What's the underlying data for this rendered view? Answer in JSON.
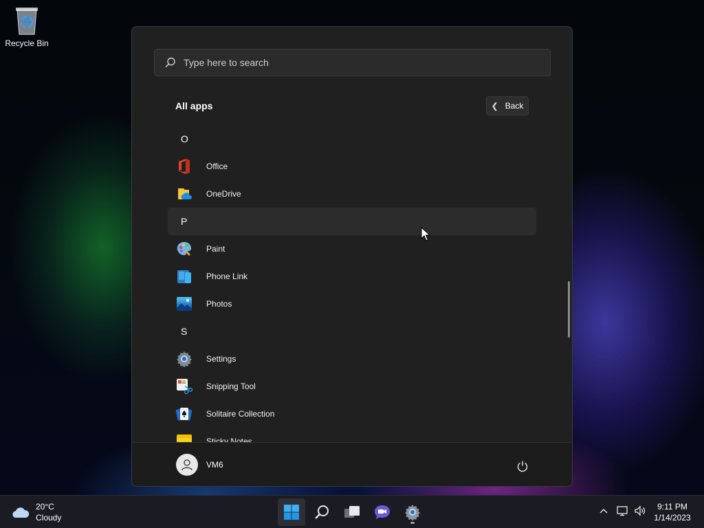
{
  "desktop": {
    "icons": [
      {
        "label": "Recycle Bin",
        "icon": "recycle-bin-icon"
      }
    ]
  },
  "start_menu": {
    "search": {
      "placeholder": "Type here to search"
    },
    "header": {
      "title": "All apps",
      "back_label": "Back"
    },
    "sections": [
      {
        "letter": "O",
        "apps": [
          {
            "name": "Office",
            "icon": "office-icon"
          },
          {
            "name": "OneDrive",
            "icon": "onedrive-icon"
          }
        ]
      },
      {
        "letter": "P",
        "highlighted": true,
        "apps": [
          {
            "name": "Paint",
            "icon": "paint-icon"
          },
          {
            "name": "Phone Link",
            "icon": "phone-link-icon"
          },
          {
            "name": "Photos",
            "icon": "photos-icon"
          }
        ]
      },
      {
        "letter": "S",
        "apps": [
          {
            "name": "Settings",
            "icon": "settings-icon"
          },
          {
            "name": "Snipping Tool",
            "icon": "snipping-tool-icon"
          },
          {
            "name": "Solitaire Collection",
            "icon": "solitaire-icon"
          },
          {
            "name": "Sticky Notes",
            "icon": "sticky-notes-icon"
          }
        ]
      }
    ],
    "footer": {
      "user_name": "VM6"
    }
  },
  "taskbar": {
    "weather": {
      "temperature": "20°C",
      "condition": "Cloudy"
    },
    "apps": [
      {
        "name": "start-button",
        "icon": "windows-logo-icon",
        "active": true
      },
      {
        "name": "search-button",
        "icon": "search-icon"
      },
      {
        "name": "task-view-button",
        "icon": "task-view-icon"
      },
      {
        "name": "chat-button",
        "icon": "teams-chat-icon"
      },
      {
        "name": "settings-taskbar-button",
        "icon": "gear-icon",
        "running": true
      }
    ],
    "tray": {
      "icons": [
        "chevron-up-icon",
        "network-icon",
        "volume-icon"
      ]
    },
    "clock": {
      "time": "9:11 PM",
      "date": "1/14/2023"
    }
  },
  "colors": {
    "menu_bg": "#202020",
    "highlight_row": "#2c2c2c",
    "taskbar_bg": "#1b1c23",
    "accent_blue": "#1a8ce0"
  }
}
